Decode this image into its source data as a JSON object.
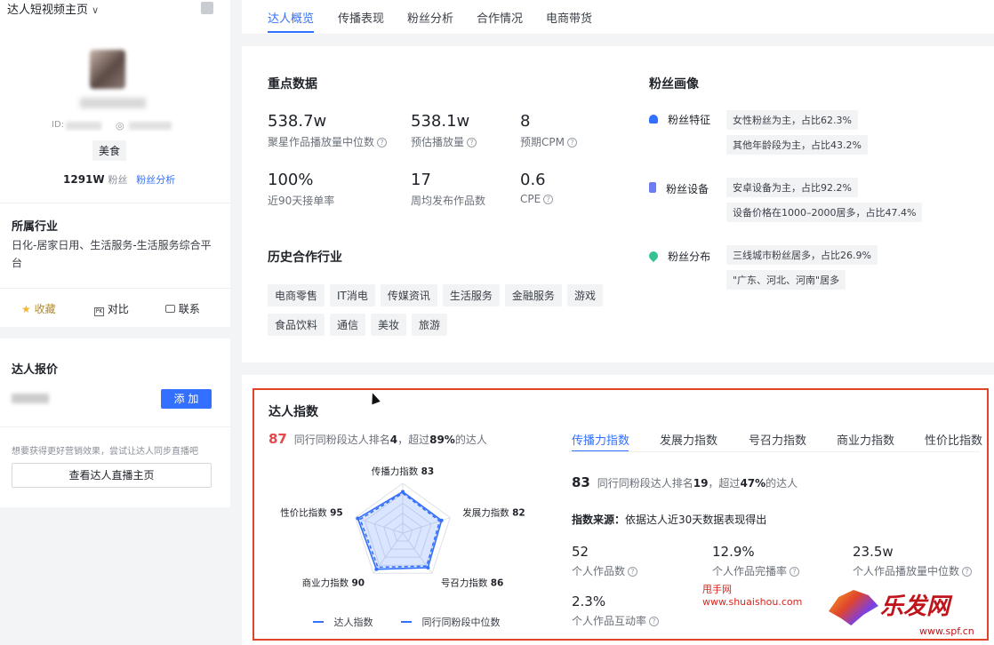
{
  "sidebar": {
    "header_title": "达人短视频主页",
    "profile": {
      "category": "美食",
      "fans_count": "1291W",
      "fans_label": "粉丝",
      "fans_analysis_link": "粉丝分析",
      "id_label": "ID:"
    },
    "industry": {
      "title": "所属行业",
      "value": "日化-居家日用、生活服务-生活服务综合平台"
    },
    "actions": {
      "collect": "收藏",
      "compare": "对比",
      "contact": "联系"
    },
    "quote": {
      "title": "达人报价",
      "add_button": "添 加",
      "tip": "想要获得更好营销效果，尝试让达人同步直播吧",
      "live_button": "查看达人直播主页"
    }
  },
  "tabs": [
    "达人概览",
    "传播表现",
    "粉丝分析",
    "合作情况",
    "电商带货"
  ],
  "key_data": {
    "title": "重点数据",
    "metrics": [
      {
        "value": "538.7w",
        "label": "聚星作品播放量中位数",
        "help": true
      },
      {
        "value": "538.1w",
        "label": "预估播放量",
        "help": true
      },
      {
        "value": "8",
        "label": "预期CPM",
        "help": true
      },
      {
        "value": "100%",
        "label": "近90天接单率",
        "help": false
      },
      {
        "value": "17",
        "label": "周均发布作品数",
        "help": false
      },
      {
        "value": "0.6",
        "label": "CPE",
        "help": true
      }
    ]
  },
  "history_industry": {
    "title": "历史合作行业",
    "tags": [
      "电商零售",
      "IT消电",
      "传媒资讯",
      "生活服务",
      "金融服务",
      "游戏",
      "食品饮料",
      "通信",
      "美妆",
      "旅游"
    ]
  },
  "fan_portrait": {
    "title": "粉丝画像",
    "rows": [
      {
        "label": "粉丝特征",
        "icon": "person-icon",
        "tags": [
          "女性粉丝为主，占比62.3%",
          "其他年龄段为主，占比43.2%"
        ]
      },
      {
        "label": "粉丝设备",
        "icon": "phone-icon",
        "tags": [
          "安卓设备为主，占比92.2%",
          "设备价格在1000–2000居多，占比47.4%"
        ]
      },
      {
        "label": "粉丝分布",
        "icon": "location-icon",
        "tags": [
          "三线城市粉丝居多，占比26.9%",
          "\"广东、河北、河南\"居多"
        ]
      }
    ]
  },
  "index_section": {
    "title": "达人指数",
    "score": "87",
    "rank_text_pre": "同行同粉段达人排名",
    "rank": "4",
    "rank_text_mid": "，超过",
    "exceed": "89%",
    "rank_text_post": "的达人",
    "sub_tabs": [
      "传播力指数",
      "发展力指数",
      "号召力指数",
      "商业力指数",
      "性价比指数"
    ],
    "active": {
      "score": "83",
      "rank_text_pre": "同行同粉段达人排名",
      "rank": "19",
      "rank_text_mid": "，超过",
      "exceed": "47%",
      "rank_text_post": "的达人",
      "source_label": "指数来源：",
      "source_value": "依据达人近30天数据表现得出",
      "stats": [
        {
          "value": "52",
          "label": "个人作品数"
        },
        {
          "value": "12.9%",
          "label": "个人作品完播率"
        },
        {
          "value": "23.5w",
          "label": "个人作品播放量中位数"
        },
        {
          "value": "2.3%",
          "label": "个人作品互动率"
        }
      ]
    }
  },
  "chart_data": {
    "type": "radar",
    "axes": [
      {
        "name": "传播力指数",
        "value": 83
      },
      {
        "name": "发展力指数",
        "value": 82
      },
      {
        "name": "号召力指数",
        "value": 86
      },
      {
        "name": "商业力指数",
        "value": 90
      },
      {
        "name": "性价比指数",
        "value": 95
      }
    ],
    "series": [
      {
        "name": "达人指数",
        "values": [
          83,
          82,
          86,
          90,
          95
        ],
        "color": "#3370ff",
        "style": "solid"
      },
      {
        "name": "同行同粉段中位数",
        "values": [
          80,
          78,
          82,
          85,
          90
        ],
        "color": "#3370ff",
        "style": "dashed"
      }
    ],
    "max": 100
  },
  "watermark": {
    "site1": "甩手网",
    "site1_url": "www.shuaishou.com",
    "site2": "乐发网",
    "site2_url": "www.spf.cn"
  },
  "colors": {
    "accent": "#3370ff",
    "danger": "#e5484d",
    "highlight_border": "#e0452c"
  }
}
